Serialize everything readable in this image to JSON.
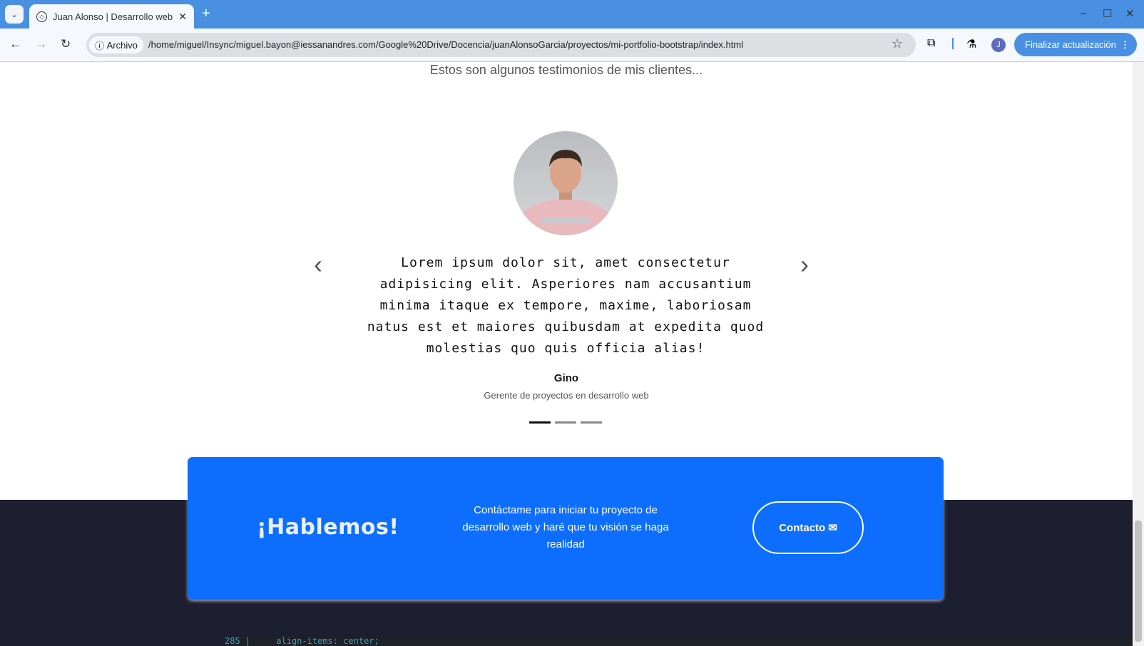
{
  "browser": {
    "tab_title": "Juan Alonso | Desarrollo web",
    "chip_label": "Archivo",
    "url": "/home/miguel/Insync/miguel.bayon@iessanandres.com/Google%20Drive/Docencia/juanAlonsoGarcia/proyectos/mi-portfolio-bootstrap/index.html",
    "avatar_letter": "J",
    "update_label": "Finalizar actualización"
  },
  "testimonials": {
    "subtitle": "Estos son algunos testimonios de mis clientes...",
    "quote": "Lorem ipsum dolor sit, amet consectetur adipisicing elit. Asperiores nam accusantium minima itaque ex tempore, maxime, laboriosam natus est et maiores quibusdam at expedita quod molestias quo quis officia alias!",
    "name": "Gino",
    "role": "Gerente de proyectos en desarrollo web",
    "active_slide": 1,
    "slide_count": 3
  },
  "cta": {
    "title": "¡Hablemos!",
    "text": "Contáctame para iniciar tu proyecto de desarrollo web y haré que tu visión se haga realidad",
    "button": "Contacto"
  },
  "code_strip": "285 |     align-items: center;",
  "colors": {
    "chrome": "#4a90e2",
    "cta_bg": "#0d6efd",
    "footer_bg": "#1d1e30"
  }
}
